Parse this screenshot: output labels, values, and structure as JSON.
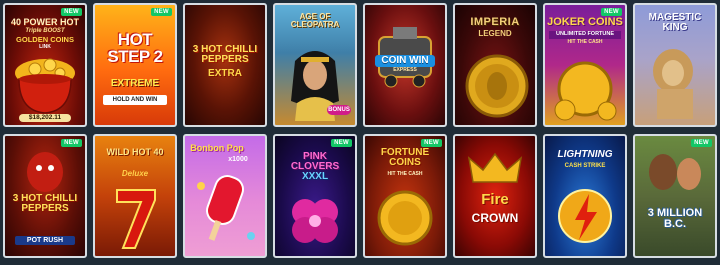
{
  "badge_new": "NEW",
  "games": [
    {
      "title": "40 POWER HOT",
      "subtitle": "Triple BOOST",
      "extra": "GOLDEN COINS",
      "extra2": "LINK",
      "amount": "$18,202.11"
    },
    {
      "title": "HOT STEP 2",
      "subtitle": "EXTREME",
      "extra": "HOLD AND WIN"
    },
    {
      "title": "3 HOT CHILLI PEPPERS",
      "subtitle": "EXTRA"
    },
    {
      "title": "AGE OF CLEOPATRA",
      "extra": "BONUS"
    },
    {
      "title": "COIN WIN",
      "subtitle": "EXPRESS"
    },
    {
      "title": "IMPERIA",
      "subtitle": "LEGEND"
    },
    {
      "title": "JOKER COINS",
      "subtitle": "UNLIMITED FORTUNE",
      "extra": "HIT THE CASH"
    },
    {
      "title": "MAGESTIC KING"
    },
    {
      "title": "3 HOT CHILLI PEPPERS",
      "subtitle": "POT RUSH"
    },
    {
      "title": "WILD HOT 40",
      "subtitle": "Deluxe"
    },
    {
      "title": "Bonbon Pop",
      "subtitle": "x1000"
    },
    {
      "title": "PINK CLOVERS",
      "subtitle": "XXXL"
    },
    {
      "title": "FORTUNE COINS",
      "subtitle": "HIT THE CASH"
    },
    {
      "title": "Fire",
      "subtitle": "CROWN"
    },
    {
      "title": "LIGHTNING",
      "subtitle": "CASH STRIKE"
    },
    {
      "title": "3 MILLION B.C."
    }
  ]
}
